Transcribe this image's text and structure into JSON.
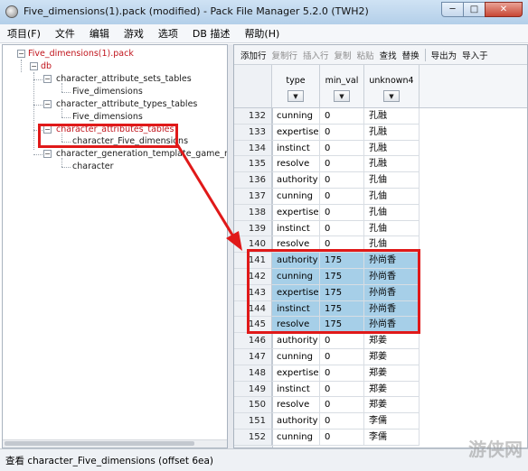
{
  "window": {
    "title": "Five_dimensions(1).pack (modified) - Pack File Manager 5.2.0 (TWH2)",
    "min_glyph": "─",
    "max_glyph": "□",
    "close_glyph": "✕"
  },
  "menu": [
    "项目(F)",
    "文件",
    "编辑",
    "游戏",
    "选项",
    "DB 描述",
    "帮助(H)"
  ],
  "tree": {
    "root": "Five_dimensions(1).pack",
    "db": "db",
    "table1": "character_attribute_sets_tables",
    "table1_child": "Five_dimensions",
    "table2": "character_attribute_types_tables",
    "table2_child": "Five_dimensions",
    "table3": "character_attributes_tables",
    "table3_child": "character_Five_dimensions",
    "table4": "character_generation_template_game_mode_",
    "table4_child": "character",
    "toggle_minus": "−"
  },
  "toolbar": {
    "add_row": "添加行",
    "copy_row": "复制行",
    "insert_row": "插入行",
    "copy": "复制",
    "paste": "粘贴",
    "find": "查找",
    "replace": "替换",
    "export": "导出为",
    "import": "导入于"
  },
  "columns": {
    "type": "type",
    "min_val": "min_val",
    "unknown4": "unknown4",
    "filter_glyph": "▼"
  },
  "rows": [
    {
      "n": "132",
      "type": "cunning",
      "min": "0",
      "u4": "孔融"
    },
    {
      "n": "133",
      "type": "expertise",
      "min": "0",
      "u4": "孔融"
    },
    {
      "n": "134",
      "type": "instinct",
      "min": "0",
      "u4": "孔融"
    },
    {
      "n": "135",
      "type": "resolve",
      "min": "0",
      "u4": "孔融"
    },
    {
      "n": "136",
      "type": "authority",
      "min": "0",
      "u4": "孔伷"
    },
    {
      "n": "137",
      "type": "cunning",
      "min": "0",
      "u4": "孔伷"
    },
    {
      "n": "138",
      "type": "expertise",
      "min": "0",
      "u4": "孔伷"
    },
    {
      "n": "139",
      "type": "instinct",
      "min": "0",
      "u4": "孔伷"
    },
    {
      "n": "140",
      "type": "resolve",
      "min": "0",
      "u4": "孔伷"
    },
    {
      "n": "141",
      "type": "authority",
      "min": "175",
      "u4": "孙尚香"
    },
    {
      "n": "142",
      "type": "cunning",
      "min": "175",
      "u4": "孙尚香"
    },
    {
      "n": "143",
      "type": "expertise",
      "min": "175",
      "u4": "孙尚香"
    },
    {
      "n": "144",
      "type": "instinct",
      "min": "175",
      "u4": "孙尚香"
    },
    {
      "n": "145",
      "type": "resolve",
      "min": "175",
      "u4": "孙尚香"
    },
    {
      "n": "146",
      "type": "authority",
      "min": "0",
      "u4": "郑姜"
    },
    {
      "n": "147",
      "type": "cunning",
      "min": "0",
      "u4": "郑姜"
    },
    {
      "n": "148",
      "type": "expertise",
      "min": "0",
      "u4": "郑姜"
    },
    {
      "n": "149",
      "type": "instinct",
      "min": "0",
      "u4": "郑姜"
    },
    {
      "n": "150",
      "type": "resolve",
      "min": "0",
      "u4": "郑姜"
    },
    {
      "n": "151",
      "type": "authority",
      "min": "0",
      "u4": "李儒"
    },
    {
      "n": "152",
      "type": "cunning",
      "min": "0",
      "u4": "李儒"
    }
  ],
  "status": "查看 character_Five_dimensions (offset 6ea)",
  "watermark": "游侠网",
  "colors": {
    "annotation": "#e01919",
    "highlight": "#a6cfe8",
    "tree_red": "#c0141c"
  }
}
